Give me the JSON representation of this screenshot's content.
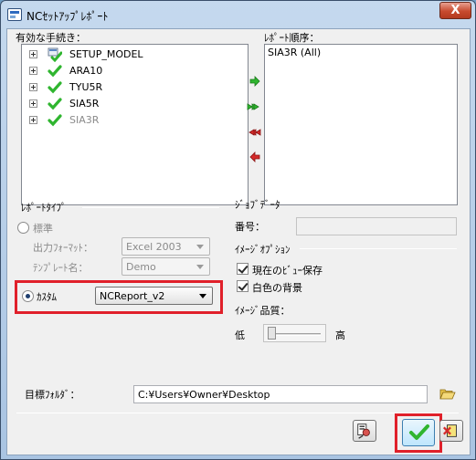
{
  "window": {
    "title": "NCｾｯﾄｱｯﾌﾟﾚﾎﾟｰﾄ",
    "close_label": "X"
  },
  "left_panel": {
    "label": "有効な手続き：",
    "items": [
      {
        "label": "SETUP_MODEL",
        "enabled": true
      },
      {
        "label": "ARA10",
        "enabled": true
      },
      {
        "label": "TYU5R",
        "enabled": true
      },
      {
        "label": "SIA5R",
        "enabled": true
      },
      {
        "label": "SIA3R",
        "enabled": false
      }
    ]
  },
  "right_panel": {
    "label": "ﾚﾎﾟｰﾄ順序：",
    "items": [
      "SIA3R (All)"
    ]
  },
  "report_type": {
    "label": "ﾚﾎﾟｰﾄﾀｲﾌﾟ",
    "standard_label": "標準",
    "output_format_label": "出力ﾌｫｰﾏｯﾄ：",
    "output_format_value": "Excel 2003",
    "template_label": "ﾃﾝﾌﾟﾚｰﾄ名：",
    "template_value": "Demo",
    "custom_label": "ｶｽﾀﾑ",
    "custom_value": "NCReport_v2"
  },
  "job_data": {
    "label": "ｼﾞｮﾌﾞﾃﾞｰﾀ",
    "number_label": "番号：",
    "image_options_label": "ｲﾒｰｼﾞｵﾌﾟｼｮﾝ",
    "save_view_label": "現在のﾋﾞｭｰ保存",
    "white_bg_label": "白色の背景",
    "quality_label": "ｲﾒｰｼﾞ品質：",
    "low_label": "低",
    "high_label": "高",
    "quality_level": 0
  },
  "target_folder": {
    "label": "目標ﾌｫﾙﾀﾞ：",
    "value": "C:¥Users¥Owner¥Desktop"
  },
  "colors": {
    "highlight_red": "#e0202a",
    "ok_green": "#2fb52f"
  }
}
